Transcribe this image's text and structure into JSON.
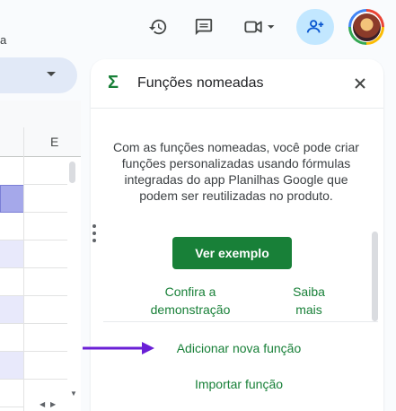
{
  "topbar": {
    "menu_fragment": "a",
    "icons": {
      "history": "history-icon",
      "comments": "comment-icon",
      "meet": "video-camera-icon",
      "share": "person-add-icon"
    }
  },
  "sheet": {
    "column_letter": "E"
  },
  "panel": {
    "icon": "Σ",
    "title": "Funções nomeadas",
    "description": "Com as funções nomeadas, você pode criar funções personalizadas usando fórmulas integradas do app Planilhas Google que podem ser reutilizadas no produto.",
    "primary_button": "Ver exemplo",
    "link_demo_line1": "Confira a",
    "link_demo_line2": "demonstração",
    "link_learn_line1": "Saiba",
    "link_learn_line2": "mais",
    "add_function": "Adicionar nova função",
    "import_function": "Importar função"
  },
  "colors": {
    "accent_green": "#188038",
    "annotation_arrow": "#6a1fd6",
    "share_button_bg": "#c2e7ff",
    "selected_cell": "#a5a8ea",
    "row_highlight": "#e8e9fb"
  }
}
